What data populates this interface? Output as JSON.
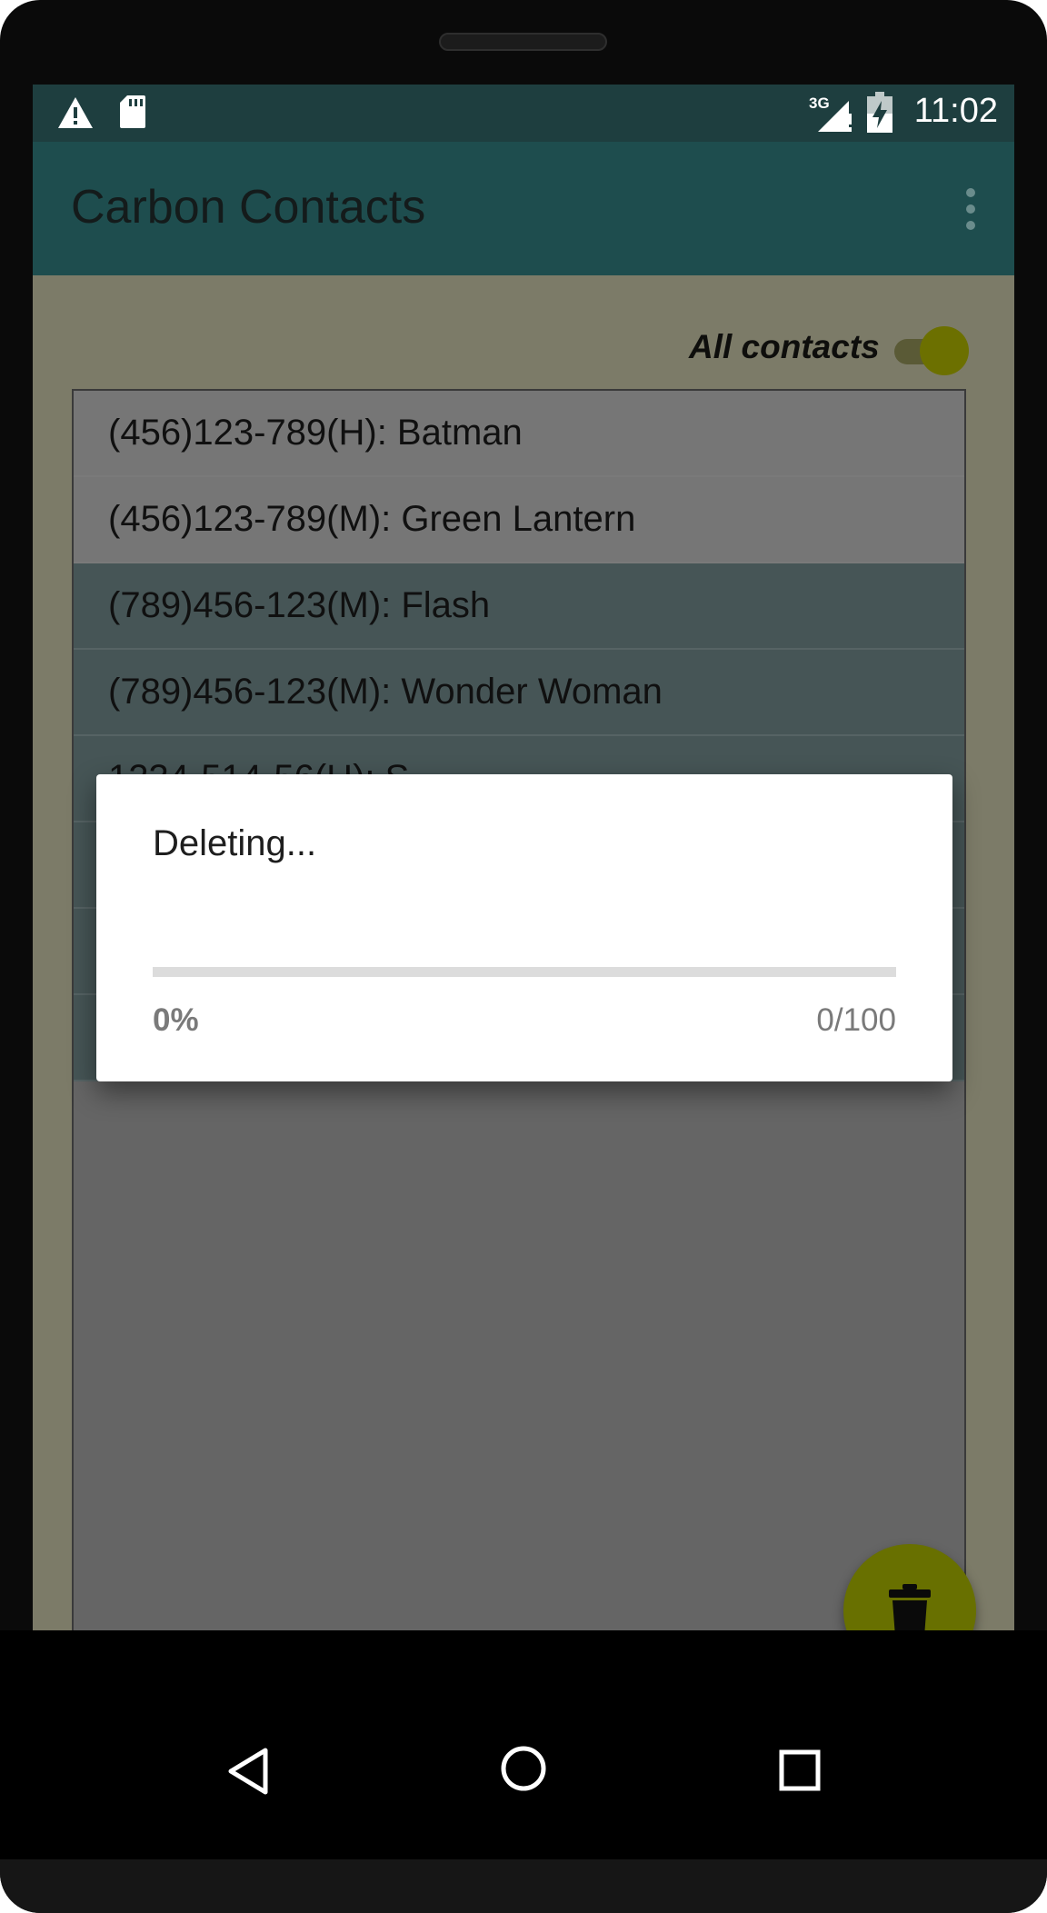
{
  "statusbar": {
    "time": "11:02",
    "network_label": "3G",
    "icons": [
      "alert-icon",
      "sd-card-icon",
      "signal-3g-icon",
      "battery-charging-icon"
    ]
  },
  "appbar": {
    "title": "Carbon Contacts",
    "overflow_icon": "more-vert-icon"
  },
  "filter": {
    "toggle_label": "All contacts",
    "toggle_on": true
  },
  "contacts": [
    {
      "text": "(456)123-789(H): Batman",
      "selected": false
    },
    {
      "text": "(456)123-789(M): Green Lantern",
      "selected": false
    },
    {
      "text": "(789)456-123(M): Flash",
      "selected": true
    },
    {
      "text": "(789)456-123(M): Wonder Woman",
      "selected": true
    },
    {
      "text": "1234-514-56(H): S",
      "selected": true
    },
    {
      "text": "",
      "selected": true
    },
    {
      "text": "",
      "selected": true
    },
    {
      "text": "",
      "selected": true
    }
  ],
  "dialog": {
    "title": "Deleting...",
    "progress_percent": "0%",
    "progress_count": "0/100",
    "progress_fraction": 0
  },
  "fab": {
    "icon": "trash-icon"
  },
  "navigation": {
    "buttons": [
      "back-icon",
      "home-icon",
      "recents-icon"
    ]
  },
  "colors": {
    "appbar": "#1e4d4e",
    "accent": "#687000",
    "selected_row": "#465556"
  }
}
